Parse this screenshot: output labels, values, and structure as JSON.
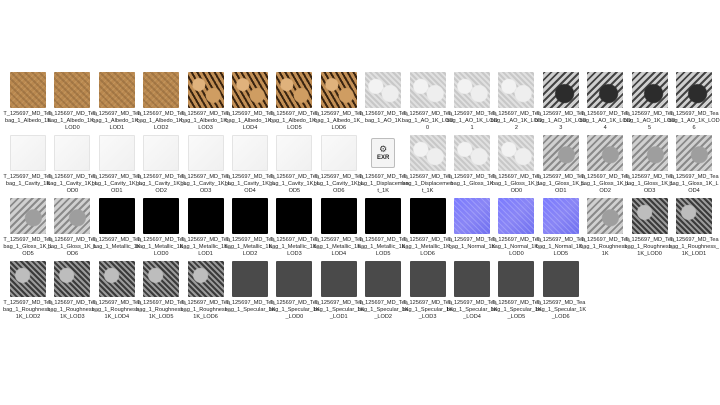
{
  "files": [
    {
      "name": "T_125697_MD_Teabag_1_Albedo_1K",
      "style": "albedo"
    },
    {
      "name": "T_125697_MD_Teabag_1_Albedo_1K_LOD0",
      "style": "albedo"
    },
    {
      "name": "T_125697_MD_Teabag_1_Albedo_1K_LOD1",
      "style": "albedo"
    },
    {
      "name": "T_125697_MD_Teabag_1_Albedo_1K_LOD2",
      "style": "albedo"
    },
    {
      "name": "T_125697_MD_Teabag_1_Albedo_1K_LOD3",
      "style": "albedo-dark"
    },
    {
      "name": "T_125697_MD_Teabag_1_Albedo_1K_LOD4",
      "style": "albedo-dark"
    },
    {
      "name": "T_125697_MD_Teabag_1_Albedo_1K_LOD5",
      "style": "albedo-dark"
    },
    {
      "name": "T_125697_MD_Teabag_1_Albedo_1K_LOD6",
      "style": "albedo-dark"
    },
    {
      "name": "T_125697_MD_Teabag_1_AO_1K",
      "style": "gray-light"
    },
    {
      "name": "T_125697_MD_Teabag_1_AO_1K_LOD0",
      "style": "gray-light"
    },
    {
      "name": "T_125697_MD_Teabag_1_AO_1K_LOD1",
      "style": "gray-light"
    },
    {
      "name": "T_125697_MD_Teabag_1_AO_1K_LOD2",
      "style": "gray-light"
    },
    {
      "name": "T_125697_MD_Teabag_1_AO_1K_LOD3",
      "style": "gray-dark"
    },
    {
      "name": "T_125697_MD_Teabag_1_AO_1K_LOD4",
      "style": "gray-dark"
    },
    {
      "name": "T_125697_MD_Teabag_1_AO_1K_LOD5",
      "style": "gray-dark"
    },
    {
      "name": "T_125697_MD_Teabag_1_AO_1K_LOD6",
      "style": "gray-dark"
    },
    {
      "name": "T_125697_MD_Teabag_1_Cavity_1K",
      "style": "white"
    },
    {
      "name": "T_125697_MD_Teabag_1_Cavity_1K_LOD0",
      "style": "white"
    },
    {
      "name": "T_125697_MD_Teabag_1_Cavity_1K_LOD1",
      "style": "white"
    },
    {
      "name": "T_125697_MD_Teabag_1_Cavity_1K_LOD2",
      "style": "white"
    },
    {
      "name": "T_125697_MD_Teabag_1_Cavity_1K_LOD3",
      "style": "white"
    },
    {
      "name": "T_125697_MD_Teabag_1_Cavity_1K_LOD4",
      "style": "white"
    },
    {
      "name": "T_125697_MD_Teabag_1_Cavity_1K_LOD5",
      "style": "white"
    },
    {
      "name": "T_125697_MD_Teabag_1_Cavity_1K_LOD6",
      "style": "white"
    },
    {
      "name": "T_125697_MD_Teabag_1_Displacement_1K",
      "style": "exr",
      "icon_text": "EXR"
    },
    {
      "name": "T_125697_MD_Teabag_1_Displacement_1K",
      "style": "gray-light"
    },
    {
      "name": "T_125697_MD_Teabag_1_Gloss_1K",
      "style": "gray-light"
    },
    {
      "name": "T_125697_MD_Teabag_1_Gloss_1K_LOD0",
      "style": "gray-light"
    },
    {
      "name": "T_125697_MD_Teabag_1_Gloss_1K_LOD1",
      "style": "gray-mid"
    },
    {
      "name": "T_125697_MD_Teabag_1_Gloss_1K_LOD2",
      "style": "gray-mid"
    },
    {
      "name": "T_125697_MD_Teabag_1_Gloss_1K_LOD3",
      "style": "gray-mid"
    },
    {
      "name": "T_125697_MD_Teabag_1_Gloss_1K_LOD4",
      "style": "gray-mid"
    },
    {
      "name": "T_125697_MD_Teabag_1_Gloss_1K_LOD5",
      "style": "gray-mid"
    },
    {
      "name": "T_125697_MD_Teabag_1_Gloss_1K_LOD6",
      "style": "gray-mid"
    },
    {
      "name": "T_125697_MD_Teabag_1_Metallic_1K",
      "style": "black"
    },
    {
      "name": "T_125697_MD_Teabag_1_Metallic_1K_LOD0",
      "style": "black"
    },
    {
      "name": "T_125697_MD_Teabag_1_Metallic_1K_LOD1",
      "style": "black"
    },
    {
      "name": "T_125697_MD_Teabag_1_Metallic_1K_LOD2",
      "style": "black"
    },
    {
      "name": "T_125697_MD_Teabag_1_Metallic_1K_LOD3",
      "style": "black"
    },
    {
      "name": "T_125697_MD_Teabag_1_Metallic_1K_LOD4",
      "style": "black"
    },
    {
      "name": "T_125697_MD_Teabag_1_Metallic_1K_LOD5",
      "style": "black"
    },
    {
      "name": "T_125697_MD_Teabag_1_Metallic_1K_LOD6",
      "style": "black"
    },
    {
      "name": "T_125697_MD_Teabag_1_Normal_1K",
      "style": "normal"
    },
    {
      "name": "T_125697_MD_Teabag_1_Normal_1K_LOD0",
      "style": "normal"
    },
    {
      "name": "T_125697_MD_Teabag_1_Normal_1K_LOD5",
      "style": "normal"
    },
    {
      "name": "T_125697_MD_Teabag_1_Roughness_1K",
      "style": "gray-mid"
    },
    {
      "name": "T_125697_MD_Teabag_1_Roughness_1K_LOD0",
      "style": "rough"
    },
    {
      "name": "T_125697_MD_Teabag_1_Roughness_1K_LOD1",
      "style": "rough"
    },
    {
      "name": "T_125697_MD_Teabag_1_Roughness_1K_LOD2",
      "style": "rough"
    },
    {
      "name": "T_125697_MD_Teabag_1_Roughness_1K_LOD3",
      "style": "rough"
    },
    {
      "name": "T_125697_MD_Teabag_1_Roughness_1K_LOD4",
      "style": "rough"
    },
    {
      "name": "T_125697_MD_Teabag_1_Roughness_1K_LOD5",
      "style": "rough"
    },
    {
      "name": "T_125697_MD_Teabag_1_Roughness_1K_LOD6",
      "style": "rough"
    },
    {
      "name": "T_125697_MD_Teabag_1_Specular_1K",
      "style": "spec"
    },
    {
      "name": "T_125697_MD_Teabag_1_Specular_1K_LOD0",
      "style": "spec"
    },
    {
      "name": "T_125697_MD_Teabag_1_Specular_1K_LOD1",
      "style": "spec"
    },
    {
      "name": "T_125697_MD_Teabag_1_Specular_1K_LOD2",
      "style": "spec"
    },
    {
      "name": "T_125697_MD_Teabag_1_Specular_1K_LOD3",
      "style": "spec"
    },
    {
      "name": "T_125697_MD_Teabag_1_Specular_1K_LOD4",
      "style": "spec"
    },
    {
      "name": "T_125697_MD_Teabag_1_Specular_1K_LOD5",
      "style": "spec"
    },
    {
      "name": "T_125697_MD_Teabag_1_Specular_1K_LOD6",
      "style": "spec"
    }
  ]
}
